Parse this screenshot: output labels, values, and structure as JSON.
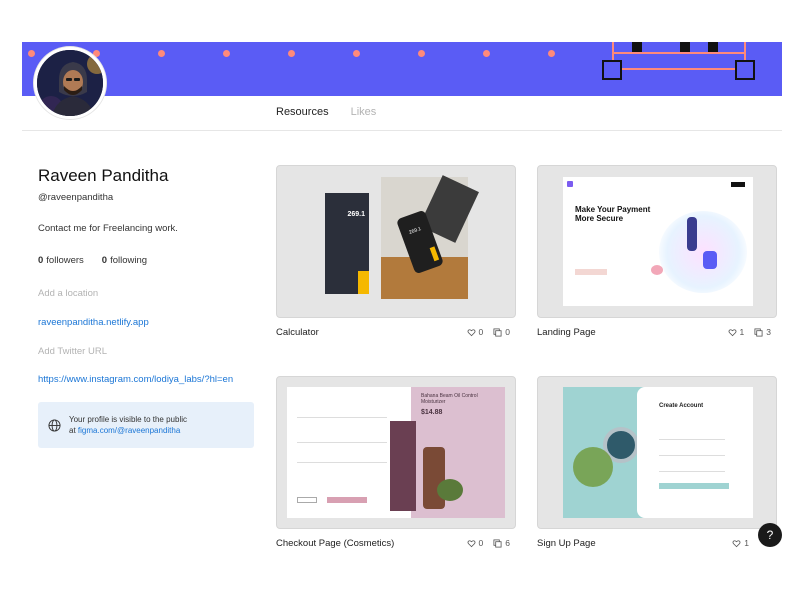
{
  "tabs": {
    "resources": "Resources",
    "likes": "Likes"
  },
  "profile": {
    "name": "Raveen Panditha",
    "handle": "@raveenpanditha",
    "bio": "Contact me for Freelancing work.",
    "followers_count": "0",
    "followers_label": "followers",
    "following_count": "0",
    "following_label": "following",
    "add_location": "Add a location",
    "website": "raveenpanditha.netlify.app",
    "add_twitter": "Add Twitter URL",
    "instagram": "https://www.instagram.com/lodiya_labs/?hl=en",
    "visibility_text": "Your profile is visible to the public",
    "visibility_at": "at",
    "visibility_link": "figma.com/@raveenpanditha"
  },
  "cards": [
    {
      "title": "Calculator",
      "likes": "0",
      "duplicates": "0"
    },
    {
      "title": "Landing Page",
      "likes": "1",
      "duplicates": "3"
    },
    {
      "title": "Checkout Page (Cosmetics)",
      "likes": "0",
      "duplicates": "6"
    },
    {
      "title": "Sign Up Page",
      "likes": "1",
      "duplicates": ""
    }
  ],
  "thumbs": {
    "calculator_display": "269.1",
    "calculator_small": "269.1",
    "landing_headline": "Make Your Payment More Secure",
    "checkout_product": "Bahana Beam Oil Control Moisturizer",
    "checkout_price": "$14.88",
    "signup_title": "Create Account"
  },
  "help_label": "?",
  "colors": {
    "banner": "#5a5cf5",
    "accent": "#ff8a7a",
    "link": "#1b76d6"
  }
}
